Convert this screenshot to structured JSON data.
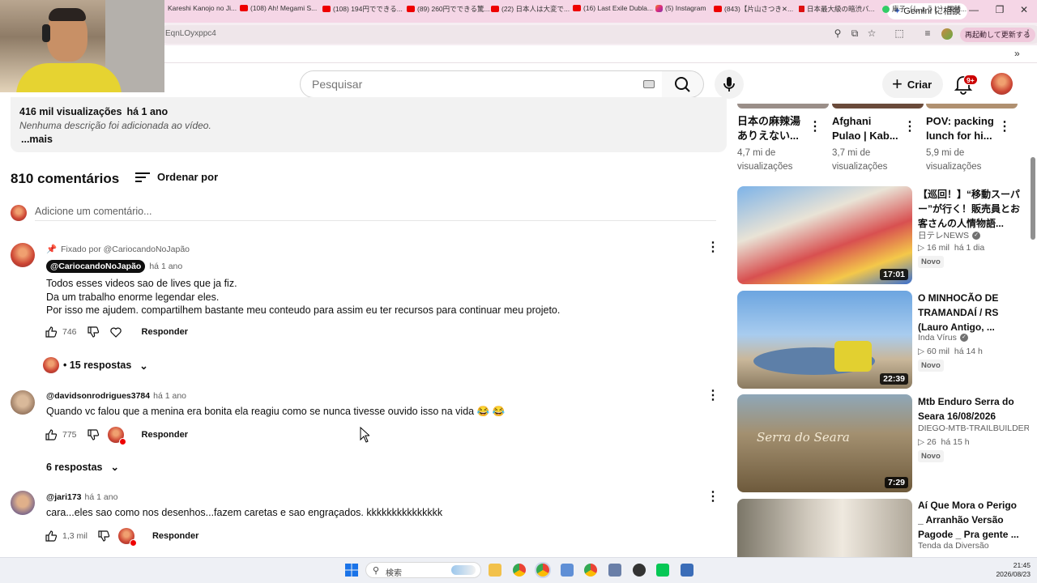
{
  "browser": {
    "url_fragment": "EqnLOyxppc4",
    "gemini_label": "Gemini に相談",
    "restart_label": "再起動して更新する",
    "bookmarks": [
      "Kareshi Kanojo no Ji...",
      "(108) Ah! Megami S...",
      "(108) 194円でできる...",
      "(89) 260円でできる驚...",
      "(22) 日本人は大変で...",
      "(16) Last Exile Dubla...",
      "(5) Instagram",
      "(843)【片山さつき✕...",
      "日本最大級の暗渋バ...",
      "庫子（しょうじ）張替..."
    ]
  },
  "youtube": {
    "search_placeholder": "Pesquisar",
    "create_label": "Criar",
    "notifications_badge": "9+"
  },
  "description": {
    "views": "416 mil visualizações",
    "age": "há 1 ano",
    "empty_text": "Nenhuma descrição foi adicionada ao vídeo.",
    "more_label": "...mais"
  },
  "comments_section": {
    "count_label": "810 comentários",
    "sort_label": "Ordenar por",
    "add_placeholder": "Adicione um comentário..."
  },
  "comments": [
    {
      "pinned_label": "Fixado por @CariocandoNoJapão",
      "handle": "@CariocandoNoJapão",
      "age": "há 1 ano",
      "lines": [
        "Todos esses videos sao de lives que ja fiz.",
        "Da um trabalho enorme legendar eles.",
        "Por isso me ajudem. compartilhem bastante meu conteudo para assim eu ter recursos para continuar meu projeto."
      ],
      "likes": "746",
      "reply_label": "Responder",
      "replies_label": "• 15 respostas"
    },
    {
      "handle": "@davidsonrodrigues3784",
      "age": "há 1 ano",
      "lines": [
        "Quando vc falou que a menina era bonita ela reagiu como se nunca tivesse ouvido isso na vida 😂 😂"
      ],
      "likes": "775",
      "reply_label": "Responder",
      "replies_label": "6 respostas"
    },
    {
      "handle": "@jari173",
      "age": "há 1 ano",
      "lines": [
        "cara...eles sao como nos desenhos...fazem caretas e sao engraçados. kkkkkkkkkkkkkkk"
      ],
      "likes": "1,3 mil",
      "reply_label": "Responder"
    }
  ],
  "sidebar": {
    "top_row": [
      {
        "title": "日本の麻辣湯ありえない...",
        "views": "4,7 mi de visualizações"
      },
      {
        "title": "Afghani Pulao | Kab...",
        "views": "3,7 mi de visualizações"
      },
      {
        "title": "POV: packing lunch for hi...",
        "views": "5,9 mi de visualizações"
      }
    ],
    "videos": [
      {
        "title": "【巡回！】“移動スーパー”が行く！販売員とお客さんの人情物語...",
        "channel": "日テレNEWS",
        "verified": true,
        "views": "16 mil",
        "age": "há 1 dia",
        "badge": "Novo",
        "duration": "17:01"
      },
      {
        "title": "O MINHOCÃO DE TRAMANDAÍ / RS (Lauro Antigo, ...",
        "channel": "Inda Vírus",
        "verified": true,
        "views": "60 mil",
        "age": "há 14 h",
        "badge": "Novo",
        "duration": "22:39"
      },
      {
        "title": "Mtb Enduro Serra do Seara 16/08/2026",
        "channel": "DIEGO-MTB-TRAILBUILDER",
        "verified": false,
        "views": "26",
        "age": "há 15 h",
        "badge": "Novo",
        "duration": "7:29",
        "thumb_text": "Serra do Seara"
      },
      {
        "title": "Aí Que Mora o Perigo _ Arranhão Versão Pagode _ Pra gente ...",
        "channel": "Tenda da Diversão"
      }
    ]
  },
  "taskbar": {
    "search_placeholder": "検索",
    "time": "21:45",
    "date": "2026/08/23"
  }
}
